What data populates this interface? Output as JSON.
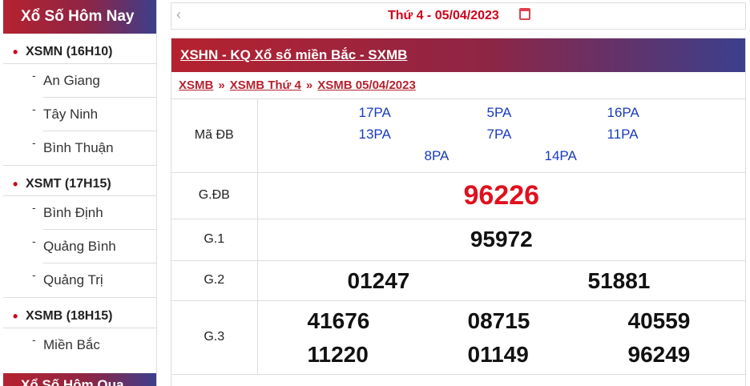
{
  "sidebar": {
    "title": "Xổ Số Hôm Nay",
    "groups": [
      {
        "title": "XSMN (16H10)",
        "items": [
          "An Giang",
          "Tây Ninh",
          "Bình Thuận"
        ]
      },
      {
        "title": "XSMT (17H15)",
        "items": [
          "Bình Định",
          "Quảng Bình",
          "Quảng Trị"
        ]
      },
      {
        "title": "XSMB (18H15)",
        "items": [
          "Miền Bắc"
        ]
      }
    ],
    "footer_title": "Xổ Số Hôm Qua"
  },
  "datebar": {
    "prev_icon": "chevron-left-icon",
    "label": "Thứ 4 - 05/04/2023",
    "calendar_icon": "calendar-icon"
  },
  "main": {
    "header": "XSHN - KQ Xổ số miền Bắc - SXMB",
    "breadcrumb": [
      "XSMB",
      "XSMB Thứ 4",
      "XSMB 05/04/2023"
    ],
    "breadcrumb_sep": "»",
    "rows": {
      "madb": {
        "label": "Mã ĐB",
        "codes": [
          "17PA",
          "5PA",
          "16PA",
          "13PA",
          "7PA",
          "11PA",
          "8PA",
          "14PA"
        ]
      },
      "gdb": {
        "label": "G.ĐB",
        "numbers": [
          "96226"
        ]
      },
      "g1": {
        "label": "G.1",
        "numbers": [
          "95972"
        ]
      },
      "g2": {
        "label": "G.2",
        "numbers": [
          "01247",
          "51881"
        ]
      },
      "g3": {
        "label": "G.3",
        "numbers": [
          "41676",
          "08715",
          "40559",
          "11220",
          "01149",
          "96249"
        ]
      }
    }
  },
  "colors": {
    "accent_red": "#d0021b",
    "header_gradient_start": "#b5222f",
    "header_gradient_end": "#3b3f8c",
    "code_blue": "#1a3bbf"
  }
}
